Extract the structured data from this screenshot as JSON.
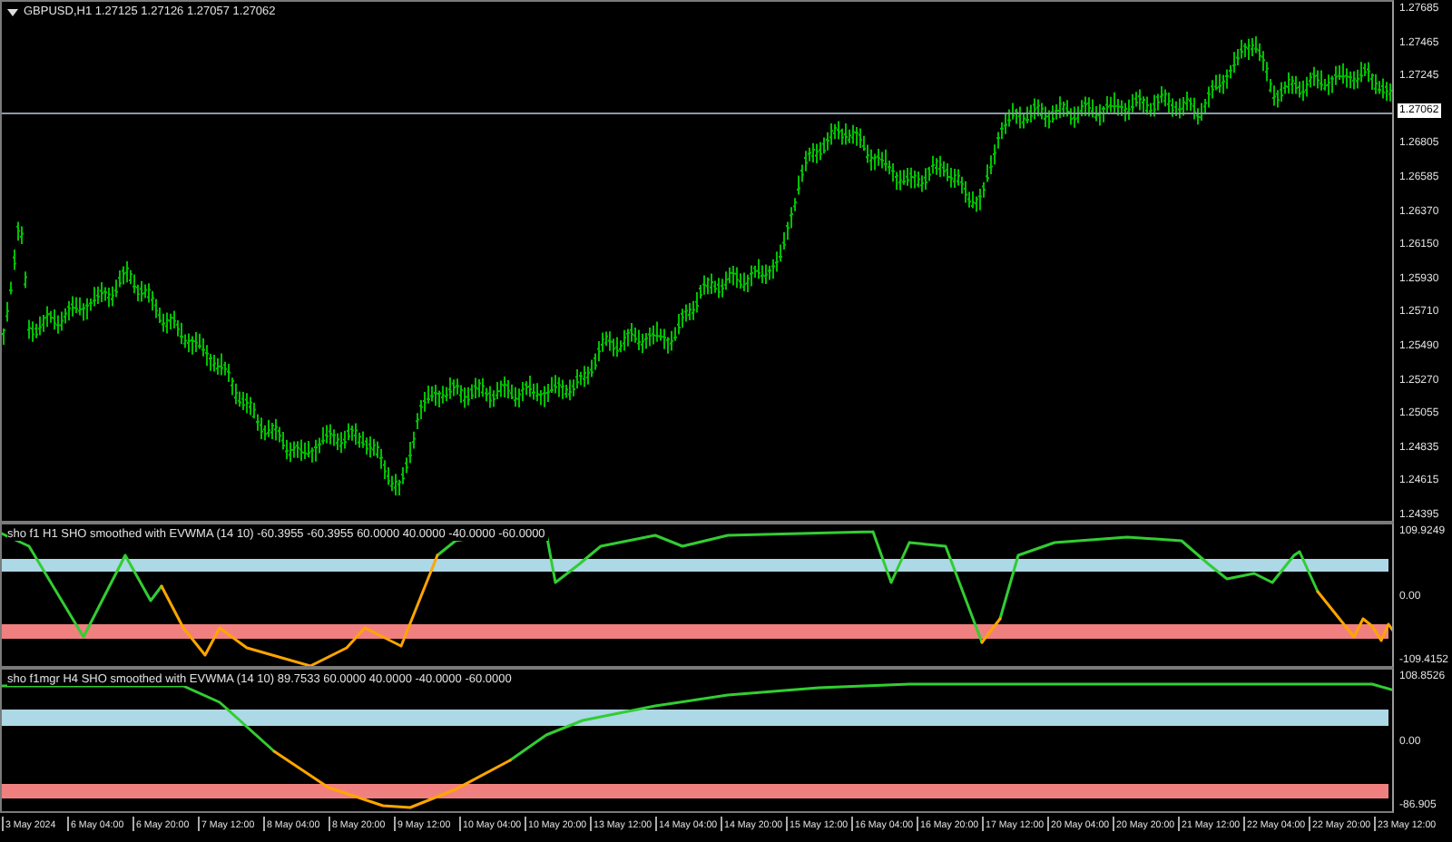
{
  "main_chart": {
    "symbol_header": "GBPUSD,H1  1.27125 1.27126 1.27057 1.27062",
    "price_axis": [
      {
        "label": "1.27685",
        "current": false
      },
      {
        "label": "1.27465",
        "current": false
      },
      {
        "label": "1.27245",
        "current": false
      },
      {
        "label": "1.27062",
        "current": true
      },
      {
        "label": "1.26805",
        "current": false
      },
      {
        "label": "1.26585",
        "current": false
      },
      {
        "label": "1.26370",
        "current": false
      },
      {
        "label": "1.26150",
        "current": false
      },
      {
        "label": "1.25930",
        "current": false
      },
      {
        "label": "1.25710",
        "current": false
      },
      {
        "label": "1.25490",
        "current": false
      },
      {
        "label": "1.25270",
        "current": false
      },
      {
        "label": "1.25055",
        "current": false
      },
      {
        "label": "1.24835",
        "current": false
      },
      {
        "label": "1.24615",
        "current": false
      },
      {
        "label": "1.24395",
        "current": false
      }
    ]
  },
  "indicators": [
    {
      "header": "sho f1  H1 SHO smoothed with EVWMA (14 10) -60.3955 -60.3955 60.0000 40.0000 -40.0000 -60.0000",
      "axis": [
        "109.9249",
        "0.00",
        "-109.4152"
      ]
    },
    {
      "header": "sho f1mgr  H4 SHO smoothed with EVWMA (14 10) 89.7533 60.0000 40.0000 -40.0000 -60.0000",
      "axis": [
        "108.8526",
        "0.00",
        "-86.905"
      ]
    }
  ],
  "time_axis": [
    "3 May 2024",
    "6 May 04:00",
    "6 May 20:00",
    "7 May 12:00",
    "8 May 04:00",
    "8 May 20:00",
    "9 May 12:00",
    "10 May 04:00",
    "10 May 20:00",
    "13 May 12:00",
    "14 May 04:00",
    "14 May 20:00",
    "15 May 12:00",
    "16 May 04:00",
    "16 May 20:00",
    "17 May 12:00",
    "20 May 04:00",
    "20 May 20:00",
    "21 May 12:00",
    "22 May 04:00",
    "22 May 20:00",
    "23 May 12:00"
  ]
}
